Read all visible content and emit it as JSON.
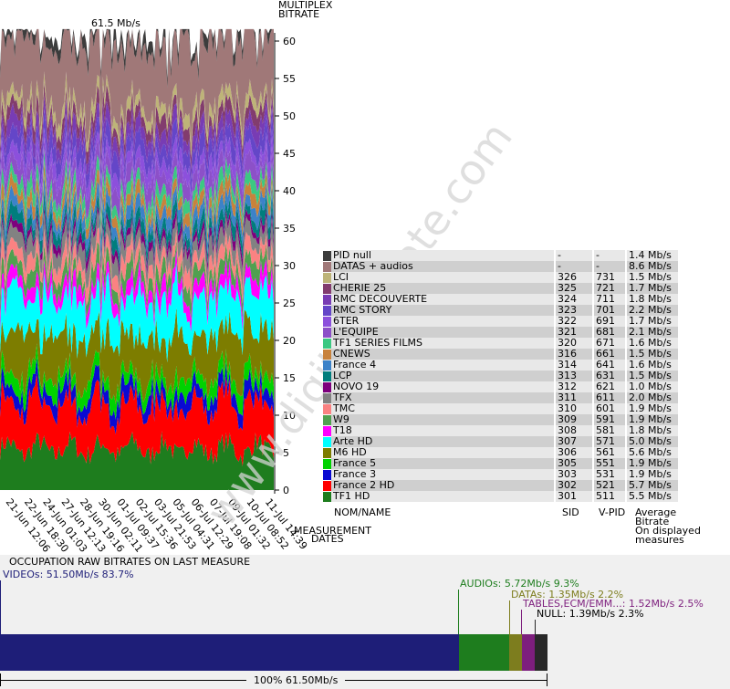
{
  "header": {
    "top_total": "61.5 Mb/s",
    "y_axis_title_1": "MULTIPLEX",
    "y_axis_title_2": "BITRATE",
    "x_axis_title_1": "MEASUREMENT",
    "x_axis_title_2": "DATES",
    "watermark": "www.digitalbitrate.com"
  },
  "chart_data": {
    "type": "area",
    "ylim": [
      0,
      62
    ],
    "y_ticks": [
      0,
      5,
      10,
      15,
      20,
      25,
      30,
      35,
      40,
      45,
      50,
      55,
      60
    ],
    "x_ticks": [
      "21-Jun 12:06",
      "22-Jun 18:30",
      "24-Jun 01:03",
      "27-Jun 12:13",
      "28-Jun 19:16",
      "30-Jun 02:11",
      "01-Jul 09:37",
      "02-Jul 15:36",
      "03-Jul 21:53",
      "05-Jul 04:31",
      "06-Jul 12:29",
      "07-Jul 19:08",
      "09-Jul 01:32",
      "10-Jul 08:52",
      "11-Jul 14:39"
    ],
    "series": [
      {
        "name": "TF1 HD",
        "value": 5.5,
        "color": "#1e7d1e"
      },
      {
        "name": "France 2 HD",
        "value": 5.7,
        "color": "#ff0000"
      },
      {
        "name": "France 3",
        "value": 1.9,
        "color": "#0a0ad2"
      },
      {
        "name": "France 5",
        "value": 1.9,
        "color": "#00d200"
      },
      {
        "name": "M6 HD",
        "value": 5.6,
        "color": "#7d7d00"
      },
      {
        "name": "Arte HD",
        "value": 5.0,
        "color": "#00ffff"
      },
      {
        "name": "T18",
        "value": 1.8,
        "color": "#ff00ff"
      },
      {
        "name": "W9",
        "value": 1.9,
        "color": "#50a050"
      },
      {
        "name": "TMC",
        "value": 1.9,
        "color": "#fa8282"
      },
      {
        "name": "TFX",
        "value": 2.0,
        "color": "#828282"
      },
      {
        "name": "NOVO 19",
        "value": 1.0,
        "color": "#7d007d"
      },
      {
        "name": "LCP",
        "value": 1.5,
        "color": "#007d7d"
      },
      {
        "name": "France 4",
        "value": 1.6,
        "color": "#3c82c8"
      },
      {
        "name": "CNEWS",
        "value": 1.5,
        "color": "#c8823c"
      },
      {
        "name": "TF1 SERIES FILMS",
        "value": 1.6,
        "color": "#3cc882"
      },
      {
        "name": "L'EQUIPE",
        "value": 2.1,
        "color": "#8c50c8"
      },
      {
        "name": "6TER",
        "value": 1.7,
        "color": "#8c50dc"
      },
      {
        "name": "RMC STORY",
        "value": 2.2,
        "color": "#6446c8"
      },
      {
        "name": "RMC DECOUVERTE",
        "value": 1.8,
        "color": "#783cb4"
      },
      {
        "name": "CHERIE 25",
        "value": 1.7,
        "color": "#823c6e"
      },
      {
        "name": "LCI",
        "value": 1.5,
        "color": "#beb478"
      },
      {
        "name": "DATAS + audios",
        "value": 8.6,
        "color": "#a07878"
      },
      {
        "name": "PID null",
        "value": 1.4,
        "color": "#3c3c3c"
      }
    ]
  },
  "legend": {
    "rows": [
      {
        "name": "PID null",
        "sid": "-",
        "vpid": "-",
        "bitrate": "1.4 Mb/s",
        "color": "#3c3c3c"
      },
      {
        "name": "DATAS + audios",
        "sid": "-",
        "vpid": "-",
        "bitrate": "8.6 Mb/s",
        "color": "#a07878"
      },
      {
        "name": "LCI",
        "sid": "326",
        "vpid": "731",
        "bitrate": "1.5 Mb/s",
        "color": "#beb478"
      },
      {
        "name": "CHERIE 25",
        "sid": "325",
        "vpid": "721",
        "bitrate": "1.7 Mb/s",
        "color": "#823c6e"
      },
      {
        "name": "RMC DECOUVERTE",
        "sid": "324",
        "vpid": "711",
        "bitrate": "1.8 Mb/s",
        "color": "#783cb4"
      },
      {
        "name": "RMC STORY",
        "sid": "323",
        "vpid": "701",
        "bitrate": "2.2 Mb/s",
        "color": "#6446c8"
      },
      {
        "name": "6TER",
        "sid": "322",
        "vpid": "691",
        "bitrate": "1.7 Mb/s",
        "color": "#8c50dc"
      },
      {
        "name": "L'EQUIPE",
        "sid": "321",
        "vpid": "681",
        "bitrate": "2.1 Mb/s",
        "color": "#8c50c8"
      },
      {
        "name": "TF1 SERIES FILMS",
        "sid": "320",
        "vpid": "671",
        "bitrate": "1.6 Mb/s",
        "color": "#3cc882"
      },
      {
        "name": "CNEWS",
        "sid": "316",
        "vpid": "661",
        "bitrate": "1.5 Mb/s",
        "color": "#c8823c"
      },
      {
        "name": "France 4",
        "sid": "314",
        "vpid": "641",
        "bitrate": "1.6 Mb/s",
        "color": "#3c82c8"
      },
      {
        "name": "LCP",
        "sid": "313",
        "vpid": "631",
        "bitrate": "1.5 Mb/s",
        "color": "#007d7d"
      },
      {
        "name": "NOVO 19",
        "sid": "312",
        "vpid": "621",
        "bitrate": "1.0 Mb/s",
        "color": "#7d007d"
      },
      {
        "name": "TFX",
        "sid": "311",
        "vpid": "611",
        "bitrate": "2.0 Mb/s",
        "color": "#828282"
      },
      {
        "name": "TMC",
        "sid": "310",
        "vpid": "601",
        "bitrate": "1.9 Mb/s",
        "color": "#fa8282"
      },
      {
        "name": "W9",
        "sid": "309",
        "vpid": "591",
        "bitrate": "1.9 Mb/s",
        "color": "#50a050"
      },
      {
        "name": "T18",
        "sid": "308",
        "vpid": "581",
        "bitrate": "1.8 Mb/s",
        "color": "#ff00ff"
      },
      {
        "name": "Arte HD",
        "sid": "307",
        "vpid": "571",
        "bitrate": "5.0 Mb/s",
        "color": "#00ffff"
      },
      {
        "name": "M6 HD",
        "sid": "306",
        "vpid": "561",
        "bitrate": "5.6 Mb/s",
        "color": "#7d7d00"
      },
      {
        "name": "France 5",
        "sid": "305",
        "vpid": "551",
        "bitrate": "1.9 Mb/s",
        "color": "#00d200"
      },
      {
        "name": "France 3",
        "sid": "303",
        "vpid": "531",
        "bitrate": "1.9 Mb/s",
        "color": "#0a0ad2"
      },
      {
        "name": "France 2 HD",
        "sid": "302",
        "vpid": "521",
        "bitrate": "5.7 Mb/s",
        "color": "#ff0000"
      },
      {
        "name": "TF1 HD",
        "sid": "301",
        "vpid": "511",
        "bitrate": "5.5 Mb/s",
        "color": "#1e7d1e"
      }
    ],
    "col_name": "NOM/NAME",
    "col_sid": "SID",
    "col_vpid": "V-PID",
    "col_br_1": "Average",
    "col_br_2": "Bitrate",
    "col_br_3": "On displayed",
    "col_br_4": "measures"
  },
  "occupation": {
    "title": "OCCUPATION RAW BITRATES ON LAST MEASURE",
    "videos": {
      "label": "VIDEOs: 51.50Mb/s  83.7%",
      "value": 51.5,
      "color": "#1e1e78"
    },
    "audios": {
      "label": "AUDIOs: 5.72Mb/s  9.3%",
      "value": 5.72,
      "color": "#1e7d1e"
    },
    "datas": {
      "label": "DATAs: 1.35Mb/s  2.2%",
      "value": 1.35,
      "color": "#7d7d1e"
    },
    "tables": {
      "label": "TABLES,ECM/EMM...: 1.52Mb/s  2.5%",
      "value": 1.52,
      "color": "#7d1e7d"
    },
    "null": {
      "label": "NULL: 1.39Mb/s  2.3%",
      "value": 1.39,
      "color": "#282828"
    },
    "total": "100%  61.50Mb/s"
  }
}
